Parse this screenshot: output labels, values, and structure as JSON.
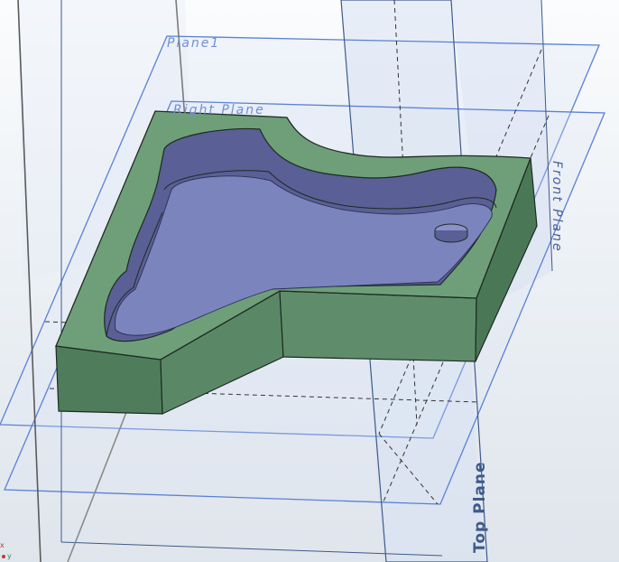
{
  "viewport": {
    "plane_labels": {
      "plane1": "Plane1",
      "right_plane": "Right Plane",
      "front_plane": "Front Plane",
      "top_plane": "Top Plane"
    },
    "triad": {
      "x_label": "x",
      "y_label": "y"
    },
    "colors": {
      "plane_border": "#5b80d6",
      "plane_label": "#6f8fd8",
      "top_plane_label": "#3f5a8a",
      "part_wall": "#5f8f6a",
      "part_top_rim": "#6f9f79",
      "pocket_floor": "#7b84bd",
      "pocket_wall": "#5a5f95",
      "edge": "#1e2a22"
    }
  }
}
